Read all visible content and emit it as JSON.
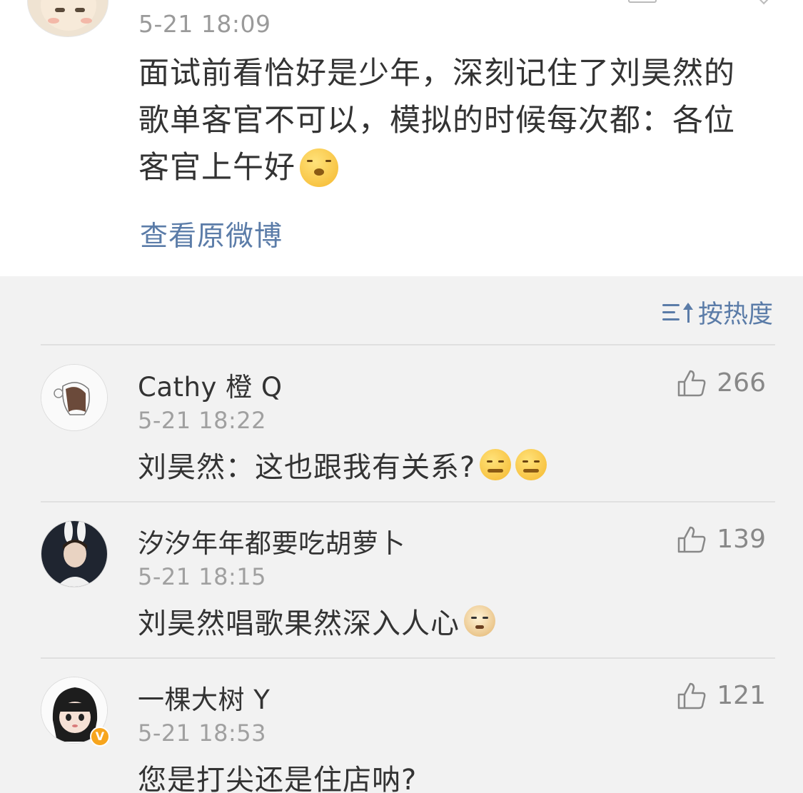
{
  "post": {
    "time": "5-21 18:09",
    "text_line1": "面试前看恰好是少年，深刻记住了刘昊然的",
    "text_line2": "歌单客官不可以，模拟的时候每次都：各位",
    "text_line3": "客官上午好",
    "view_original": "查看原微博"
  },
  "sort": {
    "label": "按热度"
  },
  "comments": [
    {
      "name": "Cathy 橙 Q",
      "time": "5-21 18:22",
      "text": "刘昊然：这也跟我有关系?",
      "likes": "266"
    },
    {
      "name": "汐汐年年都要吃胡萝卜",
      "time": "5-21 18:15",
      "text": "刘昊然唱歌果然深入人心",
      "likes": "139"
    },
    {
      "name": "一棵大树 Y",
      "time": "5-21 18:53",
      "text": "您是打尖还是住店呐?",
      "likes": "121"
    }
  ],
  "colors": {
    "link": "#5b7ca8",
    "muted": "#9a9a9a",
    "badge": "#f7a51d"
  }
}
